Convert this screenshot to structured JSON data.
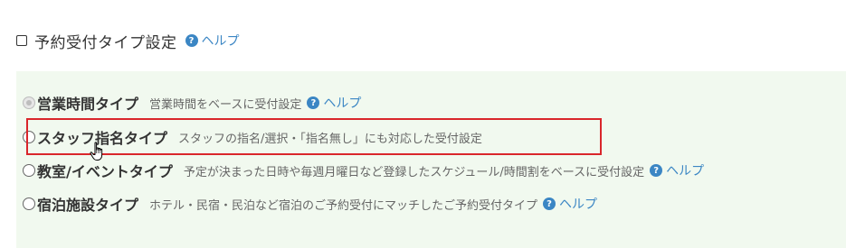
{
  "header": {
    "title": "予約受付タイプ設定",
    "help_label": "ヘルプ"
  },
  "options": [
    {
      "title": "営業時間タイプ",
      "description": "営業時間をベースに受付設定",
      "help_label": "ヘルプ",
      "state": "disabled"
    },
    {
      "title": "スタッフ指名タイプ",
      "description": "スタッフの指名/選択・「指名無し」にも対応した受付設定",
      "state": "unselected"
    },
    {
      "title": "教室/イベントタイプ",
      "description": "予定が決まった日時や毎週月曜日など登録したスケジュール/時間割をベースに受付設定",
      "help_label": "ヘルプ",
      "state": "unselected"
    },
    {
      "title": "宿泊施設タイプ",
      "description": "ホテル・民宿・民泊など宿泊のご予約受付にマッチしたご予約受付タイプ",
      "help_label": "ヘルプ",
      "state": "unselected"
    }
  ],
  "colors": {
    "panel_bg": "#f1f9ef",
    "help_link": "#3b86c4",
    "highlight": "#d9262b"
  },
  "icons": {
    "help": "question-circle-icon",
    "cursor": "hand-pointer-cursor"
  }
}
